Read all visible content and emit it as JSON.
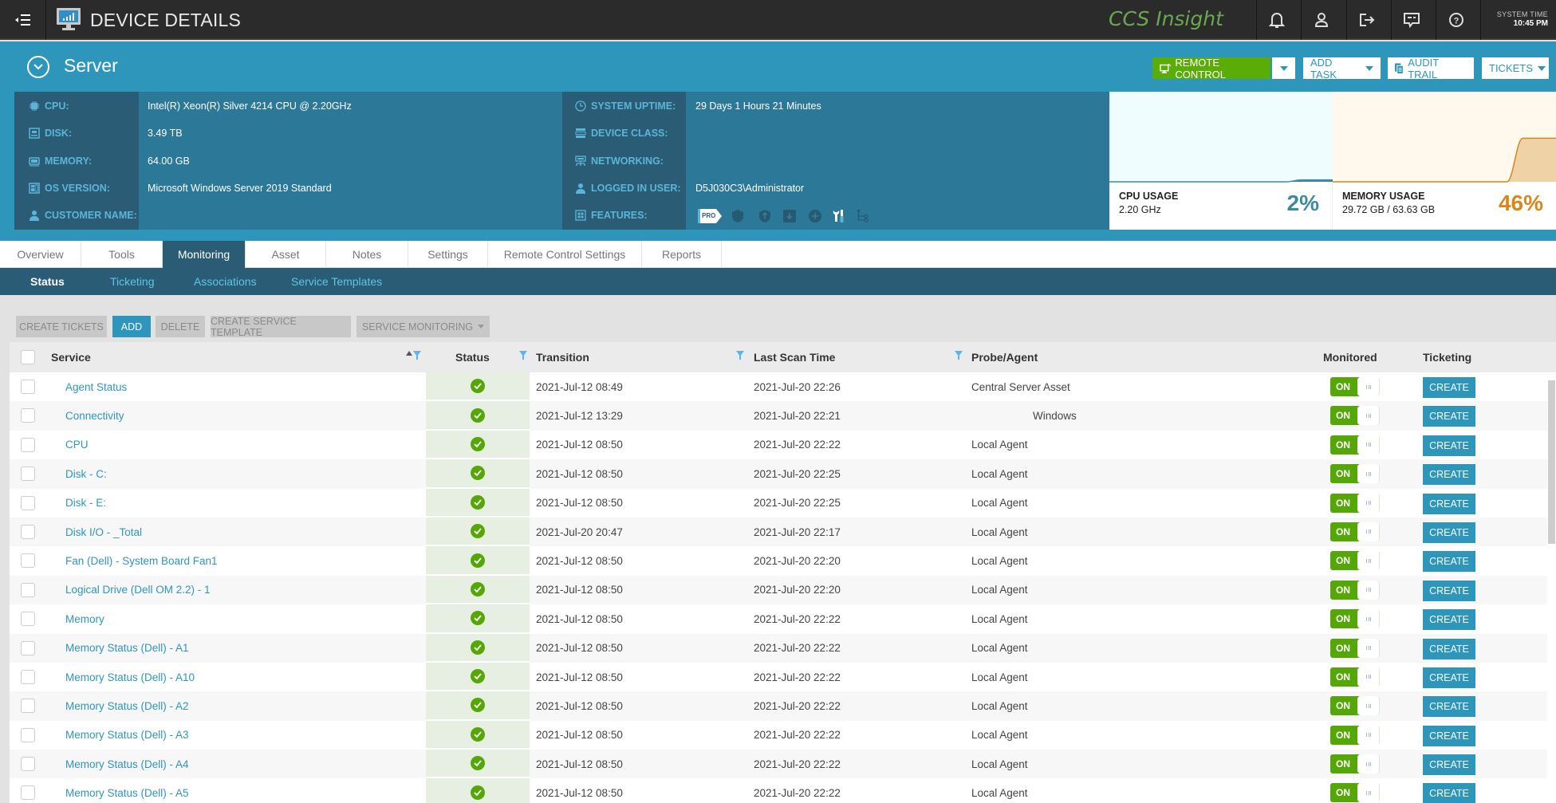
{
  "topbar": {
    "title": "DEVICE DETAILS",
    "brand": "CCS Insight",
    "icons": [
      "bell-icon",
      "user-icon",
      "logout-icon",
      "chat-icon",
      "help-icon"
    ],
    "system_time_label": "SYSTEM TIME",
    "system_time": "10:45 PM"
  },
  "device": {
    "name": "Server",
    "buttons": {
      "remote_control": "REMOTE CONTROL",
      "add_task": "ADD TASK",
      "audit_trail": "AUDIT TRAIL",
      "tickets": "TICKETS"
    },
    "info_left": [
      {
        "label": "CPU:",
        "value": "Intel(R) Xeon(R) Silver 4214 CPU @ 2.20GHz",
        "icon": "cpu-icon"
      },
      {
        "label": "DISK:",
        "value": "3.49 TB",
        "icon": "disk-icon"
      },
      {
        "label": "MEMORY:",
        "value": "64.00 GB",
        "icon": "memory-icon"
      },
      {
        "label": "OS VERSION:",
        "value": "Microsoft Windows Server 2019 Standard",
        "icon": "os-icon"
      },
      {
        "label": "CUSTOMER NAME:",
        "value": "",
        "icon": "customer-icon"
      }
    ],
    "info_right": [
      {
        "label": "SYSTEM UPTIME:",
        "value": "29 Days 1 Hours 21 Minutes",
        "icon": "clock-icon"
      },
      {
        "label": "DEVICE CLASS:",
        "value": "",
        "icon": "device-class-icon"
      },
      {
        "label": "NETWORKING:",
        "value": "",
        "icon": "networking-icon"
      },
      {
        "label": "LOGGED IN USER:",
        "value": "D5J030C3\\Administrator",
        "icon": "user-icon"
      },
      {
        "label": "FEATURES:",
        "value": "",
        "icon": "features-icon"
      }
    ],
    "features": {
      "pro_badge": "PRO",
      "icons": [
        "shield-icon",
        "shield-up-icon",
        "backup-icon",
        "patch-icon",
        "tools-icon",
        "hierarchy-icon"
      ]
    },
    "cpu_usage": {
      "title": "CPU USAGE",
      "sub": "2.20 GHz",
      "percent": "2%",
      "value": 2,
      "color": "#3d8aa0"
    },
    "memory_usage": {
      "title": "MEMORY USAGE",
      "sub": "29.72 GB / 63.63 GB",
      "percent": "46%",
      "value": 46,
      "color": "#d9861a"
    }
  },
  "tabs": [
    {
      "label": "Overview",
      "active": false
    },
    {
      "label": "Tools",
      "active": false
    },
    {
      "label": "Monitoring",
      "active": true
    },
    {
      "label": "Asset",
      "active": false
    },
    {
      "label": "Notes",
      "active": false
    },
    {
      "label": "Settings",
      "active": false
    },
    {
      "label": "Remote Control Settings",
      "active": false
    },
    {
      "label": "Reports",
      "active": false
    }
  ],
  "subtabs": [
    {
      "label": "Status",
      "active": true
    },
    {
      "label": "Ticketing",
      "active": false
    },
    {
      "label": "Associations",
      "active": false
    },
    {
      "label": "Service Templates",
      "active": false
    }
  ],
  "toolbar": {
    "create_tickets": "CREATE TICKETS",
    "add": "ADD",
    "delete": "DELETE",
    "create_service_template": "CREATE SERVICE TEMPLATE",
    "service_monitoring": "SERVICE MONITORING"
  },
  "table": {
    "columns": {
      "service": "Service",
      "status": "Status",
      "transition": "Transition",
      "last_scan": "Last Scan Time",
      "probe": "Probe/Agent",
      "monitored": "Monitored",
      "ticketing": "Ticketing"
    },
    "toggle_label": "ON",
    "create_label": "CREATE",
    "rows": [
      {
        "service": "Agent Status",
        "status": "ok",
        "transition": "2021-Jul-12 08:49",
        "last_scan": "2021-Jul-20 22:26",
        "probe": "Central Server Asset",
        "monitored": "ON"
      },
      {
        "service": "Connectivity",
        "status": "ok",
        "transition": "2021-Jul-12 13:29",
        "last_scan": "2021-Jul-20 22:21",
        "probe": "Windows",
        "monitored": "ON"
      },
      {
        "service": "CPU",
        "status": "ok",
        "transition": "2021-Jul-12 08:50",
        "last_scan": "2021-Jul-20 22:22",
        "probe": "Local Agent",
        "monitored": "ON"
      },
      {
        "service": "Disk - C:",
        "status": "ok",
        "transition": "2021-Jul-12 08:50",
        "last_scan": "2021-Jul-20 22:25",
        "probe": "Local Agent",
        "monitored": "ON"
      },
      {
        "service": "Disk - E:",
        "status": "ok",
        "transition": "2021-Jul-12 08:50",
        "last_scan": "2021-Jul-20 22:25",
        "probe": "Local Agent",
        "monitored": "ON"
      },
      {
        "service": "Disk I/O - _Total",
        "status": "ok",
        "transition": "2021-Jul-20 20:47",
        "last_scan": "2021-Jul-20 22:17",
        "probe": "Local Agent",
        "monitored": "ON"
      },
      {
        "service": "Fan (Dell) - System Board Fan1",
        "status": "ok",
        "transition": "2021-Jul-12 08:50",
        "last_scan": "2021-Jul-20 22:20",
        "probe": "Local Agent",
        "monitored": "ON"
      },
      {
        "service": "Logical Drive (Dell OM 2.2) - 1",
        "status": "ok",
        "transition": "2021-Jul-12 08:50",
        "last_scan": "2021-Jul-20 22:20",
        "probe": "Local Agent",
        "monitored": "ON"
      },
      {
        "service": "Memory",
        "status": "ok",
        "transition": "2021-Jul-12 08:50",
        "last_scan": "2021-Jul-20 22:22",
        "probe": "Local Agent",
        "monitored": "ON"
      },
      {
        "service": "Memory Status (Dell) - A1",
        "status": "ok",
        "transition": "2021-Jul-12 08:50",
        "last_scan": "2021-Jul-20 22:22",
        "probe": "Local Agent",
        "monitored": "ON"
      },
      {
        "service": "Memory Status (Dell) - A10",
        "status": "ok",
        "transition": "2021-Jul-12 08:50",
        "last_scan": "2021-Jul-20 22:22",
        "probe": "Local Agent",
        "monitored": "ON"
      },
      {
        "service": "Memory Status (Dell) - A2",
        "status": "ok",
        "transition": "2021-Jul-12 08:50",
        "last_scan": "2021-Jul-20 22:22",
        "probe": "Local Agent",
        "monitored": "ON"
      },
      {
        "service": "Memory Status (Dell) - A3",
        "status": "ok",
        "transition": "2021-Jul-12 08:50",
        "last_scan": "2021-Jul-20 22:22",
        "probe": "Local Agent",
        "monitored": "ON"
      },
      {
        "service": "Memory Status (Dell) - A4",
        "status": "ok",
        "transition": "2021-Jul-12 08:50",
        "last_scan": "2021-Jul-20 22:22",
        "probe": "Local Agent",
        "monitored": "ON"
      },
      {
        "service": "Memory Status (Dell) - A5",
        "status": "ok",
        "transition": "2021-Jul-12 08:50",
        "last_scan": "2021-Jul-20 22:22",
        "probe": "Local Agent",
        "monitored": "ON"
      }
    ]
  }
}
